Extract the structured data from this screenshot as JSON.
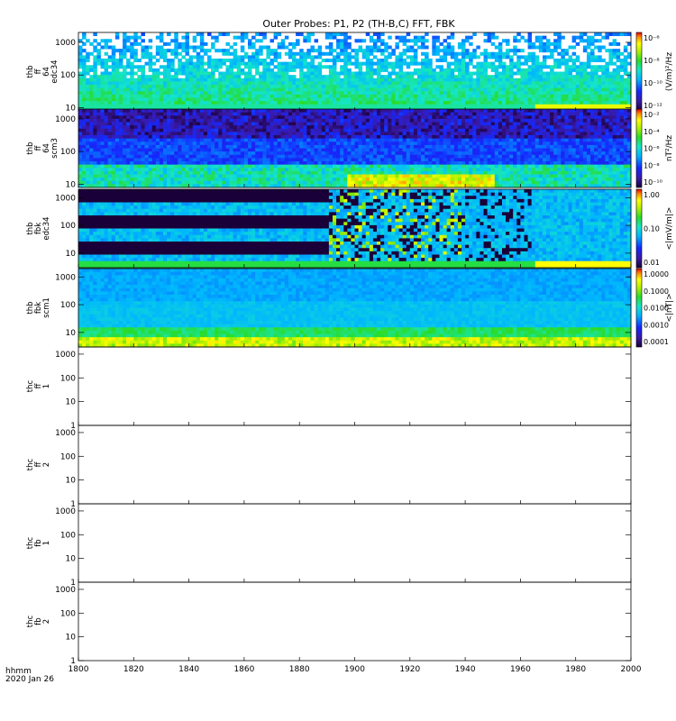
{
  "chart_data": {
    "type": "heatmap",
    "title": "Outer Probes: P1, P2 (TH-B,C) FFT, FBK",
    "x_axis": {
      "range": [
        1800,
        2000
      ],
      "ticks": [
        "1800",
        "1820",
        "1840",
        "1860",
        "1880",
        "1900",
        "1920",
        "1940",
        "1960",
        "1980",
        "2000"
      ],
      "footer_label": "hhmm",
      "footer_date": "2020 Jan 26"
    },
    "panels": [
      {
        "label": [
          "thb",
          "ff",
          "64",
          "edc34"
        ],
        "y_scale": "log",
        "y_range": [
          8,
          2000
        ],
        "y_ticks": [
          "10",
          "100",
          "1000"
        ],
        "colorbar": {
          "unit": "(V/m)²/Hz",
          "scale": "log",
          "ticks": [
            "10⁻⁶",
            "10⁻⁸",
            "10⁻¹⁰",
            "10⁻¹²"
          ]
        },
        "has_data": true
      },
      {
        "label": [
          "thb",
          "ff",
          "64",
          "scm3"
        ],
        "y_scale": "log",
        "y_range": [
          8,
          2000
        ],
        "y_ticks": [
          "10",
          "100",
          "1000"
        ],
        "colorbar": {
          "unit": "nT²/Hz",
          "scale": "log",
          "ticks": [
            "10⁻²",
            "10⁻⁴",
            "10⁻⁶",
            "10⁻⁸",
            "10⁻¹⁰"
          ]
        },
        "has_data": true
      },
      {
        "label": [
          "thb",
          "fbk",
          "edc34"
        ],
        "y_scale": "log",
        "y_range": [
          3,
          2000
        ],
        "y_ticks": [
          "10",
          "100",
          "1000"
        ],
        "colorbar": {
          "unit": "<|mV/m|>",
          "scale": "log",
          "ticks": [
            "1.00",
            "0.10",
            "0.01"
          ]
        },
        "has_data": true
      },
      {
        "label": [
          "thb",
          "fbk",
          "scm1"
        ],
        "y_scale": "log",
        "y_range": [
          3,
          2000
        ],
        "y_ticks": [
          "10",
          "100",
          "1000"
        ],
        "colorbar": {
          "unit": "<|nT|>",
          "scale": "log",
          "ticks": [
            "1.0000",
            "0.1000",
            "0.0100",
            "0.0010",
            "0.0001"
          ]
        },
        "has_data": true
      },
      {
        "label": [
          "thc",
          "ff",
          "1"
        ],
        "y_scale": "log",
        "y_range": [
          1,
          2000
        ],
        "y_ticks": [
          "1",
          "10",
          "100",
          "1000"
        ],
        "has_data": false
      },
      {
        "label": [
          "thc",
          "ff",
          "2"
        ],
        "y_scale": "log",
        "y_range": [
          1,
          2000
        ],
        "y_ticks": [
          "1",
          "10",
          "100",
          "1000"
        ],
        "has_data": false
      },
      {
        "label": [
          "thc",
          "fb",
          "1"
        ],
        "y_scale": "log",
        "y_range": [
          1,
          2000
        ],
        "y_ticks": [
          "1",
          "10",
          "100",
          "1000"
        ],
        "has_data": false
      },
      {
        "label": [
          "thc",
          "fb",
          "2"
        ],
        "y_scale": "log",
        "y_range": [
          1,
          2000
        ],
        "y_ticks": [
          "1",
          "10",
          "100",
          "1000"
        ],
        "has_data": false
      }
    ]
  }
}
